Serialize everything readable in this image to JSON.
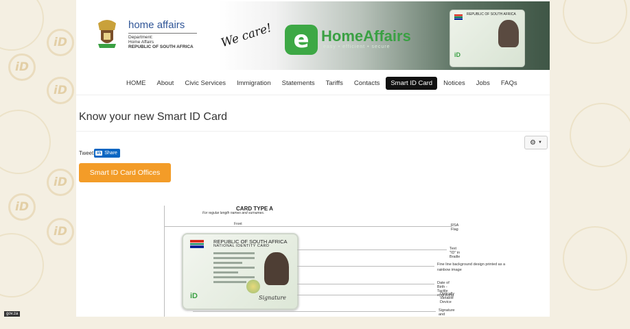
{
  "header": {
    "org_title": "home affairs",
    "org_sub_lines": [
      "Department:",
      "Home Affairs",
      "REPUBLIC OF SOUTH AFRICA"
    ],
    "slogan": "We care!",
    "brand_name": "HomeAffairs",
    "brand_tagline": "easy • efficient • secure",
    "card_caption": "REPUBLIC OF SOUTH AFRICA"
  },
  "nav": {
    "items": [
      {
        "label": "HOME"
      },
      {
        "label": "About"
      },
      {
        "label": "Civic Services"
      },
      {
        "label": "Immigration"
      },
      {
        "label": "Statements"
      },
      {
        "label": "Tariffs"
      },
      {
        "label": "Contacts"
      },
      {
        "label": "Smart ID Card",
        "active": true
      },
      {
        "label": "Notices"
      },
      {
        "label": "Jobs"
      },
      {
        "label": "FAQs"
      }
    ]
  },
  "main": {
    "title": "Know your new Smart ID Card",
    "tools_icon": "gear-icon",
    "tweet_label": "Tweet",
    "share_label": "Share",
    "offices_button": "Smart ID Card Offices"
  },
  "diagram": {
    "title": "CARD TYPE A",
    "subtitle": "For regular length names and surnames.",
    "front_label": "Front",
    "card_header": "REPUBLIC OF SOUTH AFRICA",
    "card_subheader": "NATIONAL IDENTITY CARD",
    "callouts": [
      "RSA Flag",
      "Text \"ID\" in Braille",
      "Fine line background design printed as a rainbow image",
      "Date of Birth - Tactile engraving",
      "Optically Variable Device",
      "Signature and information fields"
    ]
  },
  "footer": {
    "badge": "gov.za"
  },
  "colors": {
    "accent_orange": "#f39c28",
    "brand_green": "#3aa043",
    "link_blue": "#2f5597",
    "nav_active_bg": "#111111"
  }
}
